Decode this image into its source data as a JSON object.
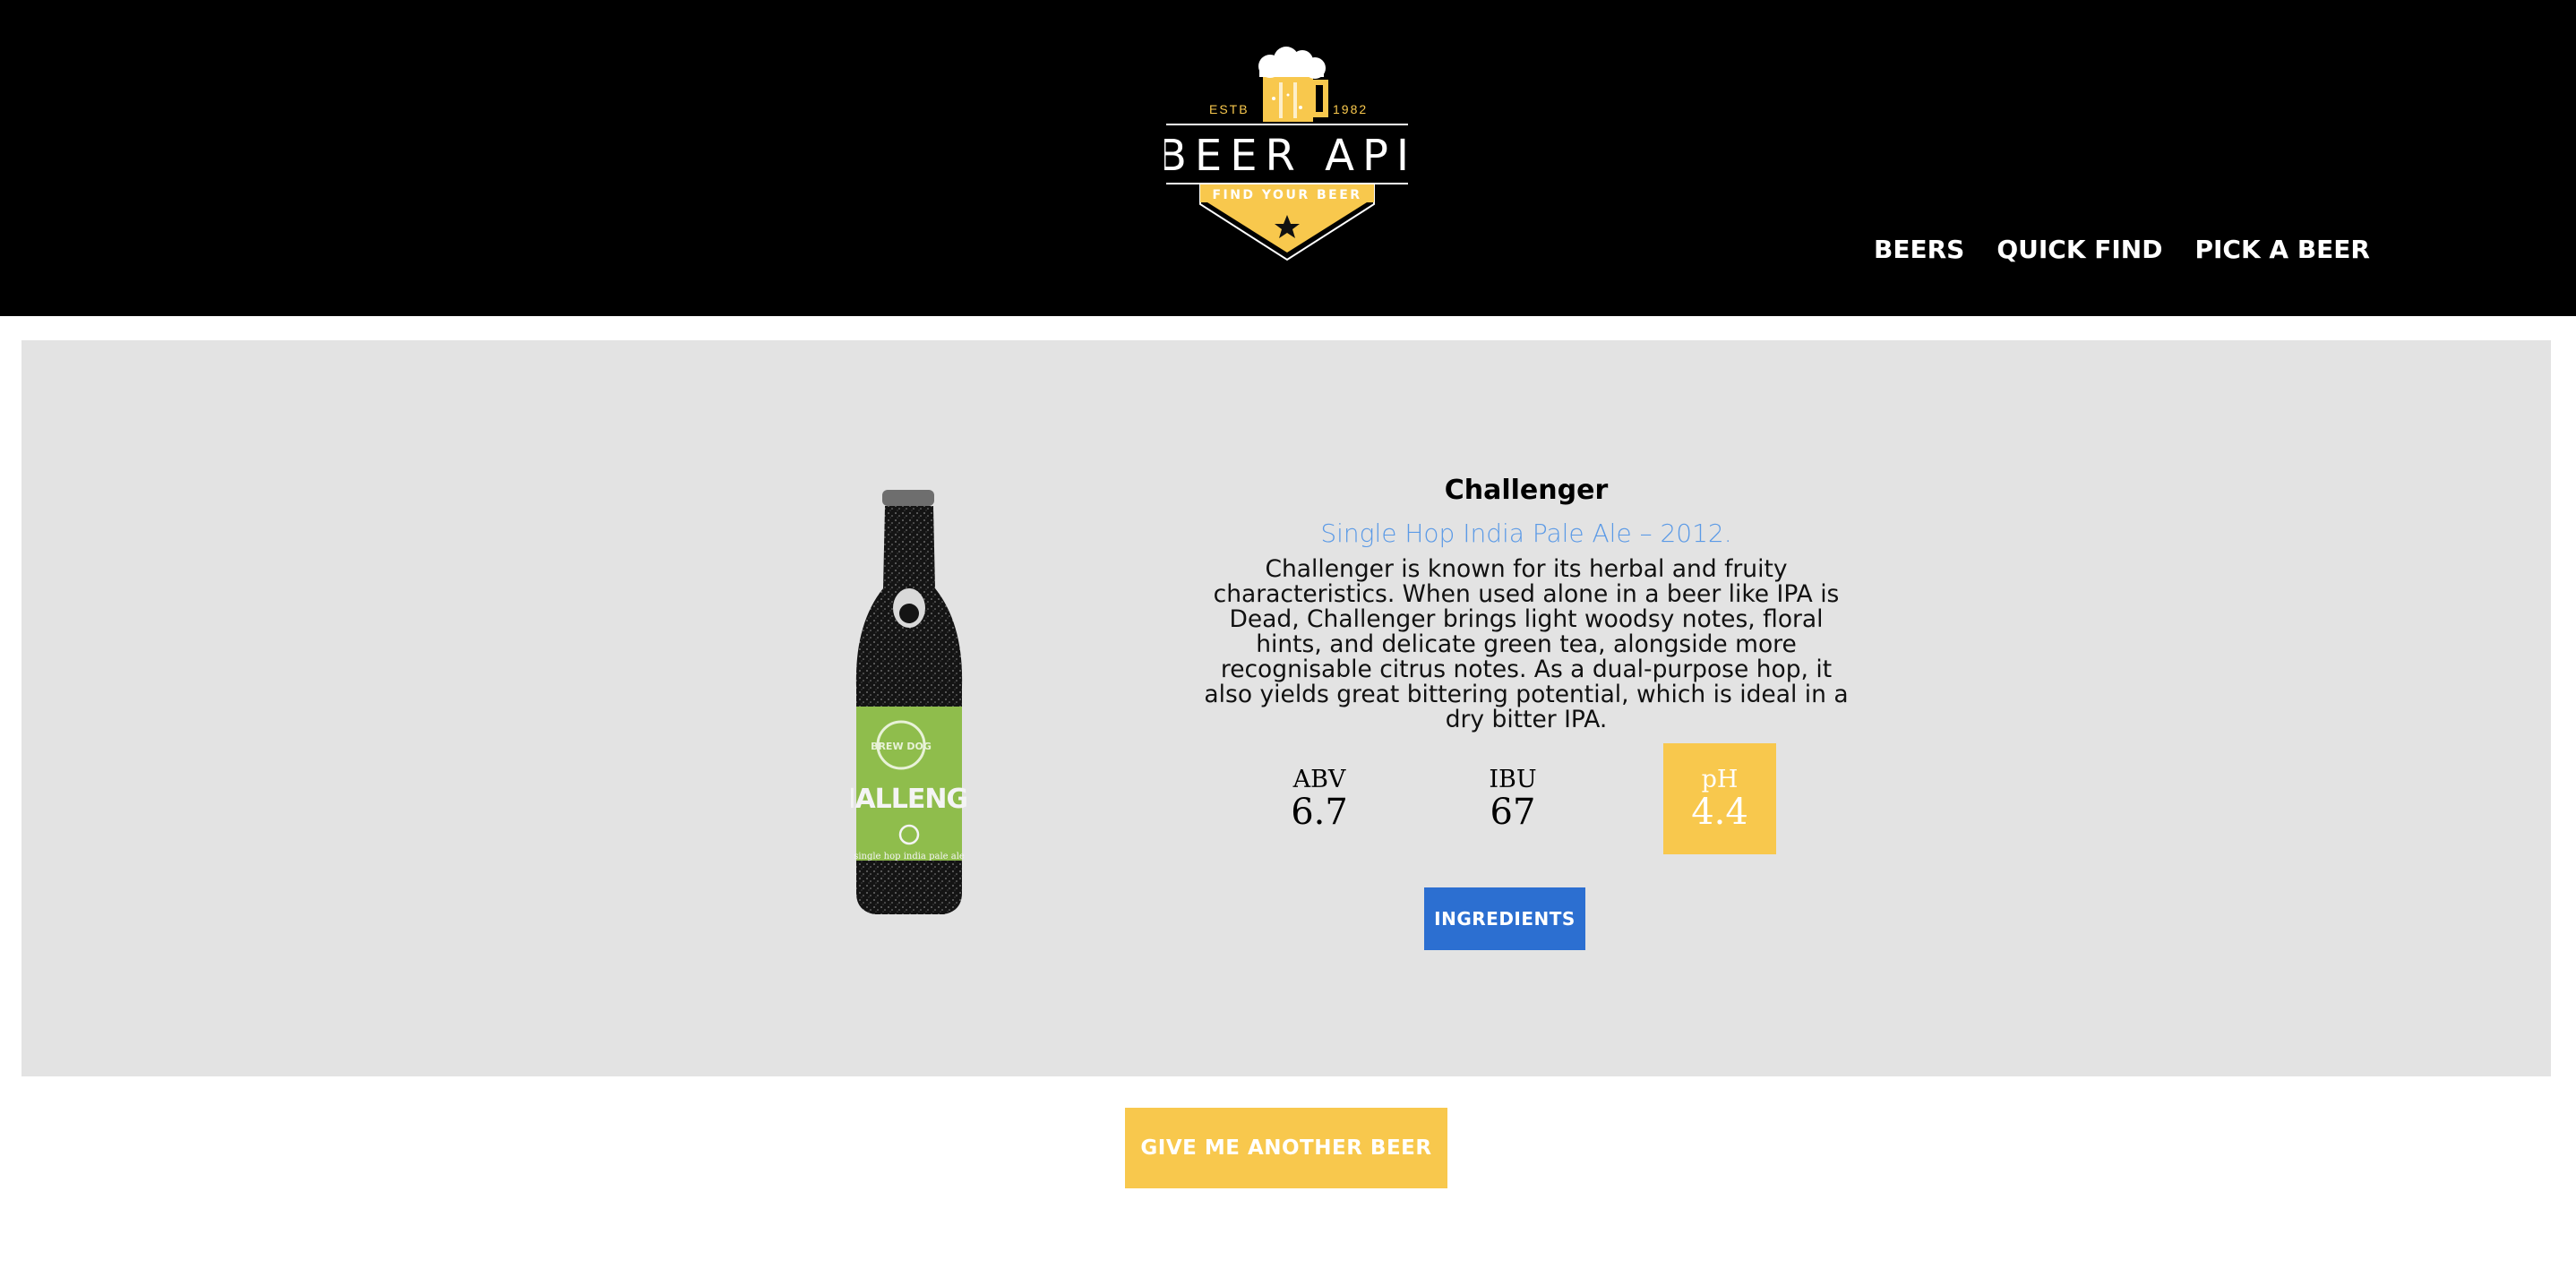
{
  "header": {
    "logo": {
      "established_label": "ESTB",
      "established_year": "1982",
      "title": "BEER API",
      "slogan": "FIND YOUR BEER",
      "colors": {
        "accent": "#f8c84d",
        "background": "#000000"
      }
    },
    "nav": [
      {
        "label": "BEERS"
      },
      {
        "label": "QUICK FIND"
      },
      {
        "label": "PICK A BEER"
      }
    ]
  },
  "beer": {
    "name": "Challenger",
    "tagline": "Single Hop India Pale Ale – 2012.",
    "description": "Challenger is known for its herbal and fruity characteristics. When used alone in a beer like IPA is Dead, Challenger brings light woodsy notes, floral hints, and delicate green tea, alongside more recognisable citrus notes. As a dual-purpose hop, it also yields great bittering potential, which is ideal in a dry bitter IPA.",
    "image": {
      "label_text": "HALLENGE",
      "brand_text": "BREW DOG",
      "subtext": "single hop india pale ale",
      "label_color": "#8fbd4c"
    },
    "stats": {
      "abv": {
        "label": "ABV",
        "value": "6.7"
      },
      "ibu": {
        "label": "IBU",
        "value": "67"
      },
      "ph": {
        "label": "pH",
        "value": "4.4"
      }
    },
    "ingredients_label": "INGREDIENTS"
  },
  "actions": {
    "another_label": "GIVE ME ANOTHER BEER"
  },
  "colors": {
    "primary_button": "#2c6fd1",
    "accent_button": "#f8c84d",
    "card_background": "#e3e3e3",
    "tagline": "#5b9ae6"
  }
}
